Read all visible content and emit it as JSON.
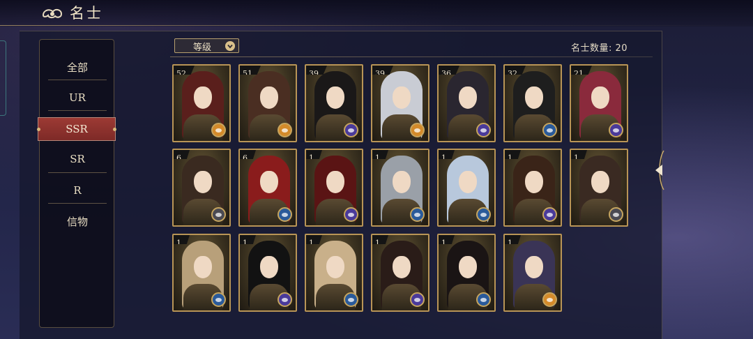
{
  "header": {
    "title": "名士",
    "back_icon": "cloud-back-icon"
  },
  "filter": {
    "sort_label": "等级",
    "count_label": "名士数量: 20"
  },
  "sidebar": {
    "items": [
      {
        "label": "全部",
        "active": false
      },
      {
        "label": "UR",
        "active": false
      },
      {
        "label": "SSR",
        "active": true
      },
      {
        "label": "SR",
        "active": false
      },
      {
        "label": "R",
        "active": false
      },
      {
        "label": "信物",
        "active": false
      }
    ]
  },
  "colors": {
    "accent_gold": "#b99556",
    "active_red": "#8c322e",
    "panel": "#16182e"
  },
  "cards": [
    {
      "level": "52",
      "badge": "gold",
      "hair": "#5a1f1c"
    },
    {
      "level": "51",
      "badge": "gold",
      "hair": "#4a2e22"
    },
    {
      "level": "39",
      "badge": "purple",
      "hair": "#1a1818"
    },
    {
      "level": "39",
      "badge": "gold",
      "hair": "#c9ccd4"
    },
    {
      "level": "36",
      "badge": "purple",
      "hair": "#2a2630"
    },
    {
      "level": "32",
      "badge": "blue",
      "hair": "#1e1e1e"
    },
    {
      "level": "21",
      "badge": "purple",
      "hair": "#8a2a3c"
    },
    {
      "level": "6",
      "badge": "gray",
      "hair": "#3a2a20"
    },
    {
      "level": "6",
      "badge": "blue",
      "hair": "#8a1c1c"
    },
    {
      "level": "1",
      "badge": "purple",
      "hair": "#5a1414"
    },
    {
      "level": "1",
      "badge": "blue",
      "hair": "#9aa0a8"
    },
    {
      "level": "1",
      "badge": "blue",
      "hair": "#b8c8dc"
    },
    {
      "level": "1",
      "badge": "purple",
      "hair": "#3a2418"
    },
    {
      "level": "1",
      "badge": "gray",
      "hair": "#3a2a22"
    },
    {
      "level": "1",
      "badge": "blue",
      "hair": "#b8a07a"
    },
    {
      "level": "1",
      "badge": "purple",
      "hair": "#121212"
    },
    {
      "level": "1",
      "badge": "blue",
      "hair": "#c9b08a"
    },
    {
      "level": "1",
      "badge": "purple",
      "hair": "#2a1c18"
    },
    {
      "level": "1",
      "badge": "blue",
      "hair": "#1a1414"
    },
    {
      "level": "1",
      "badge": "gold",
      "hair": "#3a3456"
    }
  ],
  "badge_colors": {
    "gold": "#d48a2a",
    "purple": "#4a3a9a",
    "blue": "#2a5a9a",
    "gray": "#4a4a52"
  }
}
